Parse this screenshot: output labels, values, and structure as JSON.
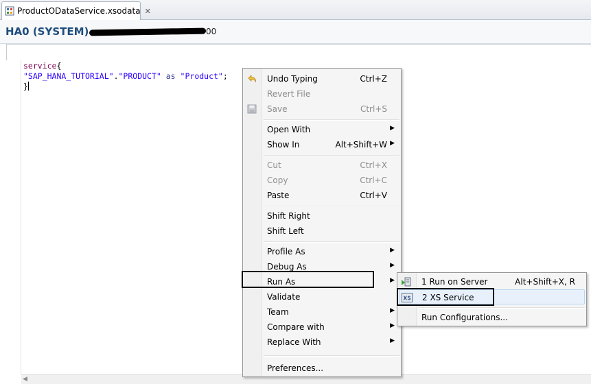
{
  "editor_tab": {
    "filename": "ProductODataService.xsodata",
    "file_icon": "xsodata-file-icon",
    "close_icon": "close-icon"
  },
  "system_header": {
    "title": "HA0 (SYSTEM)",
    "suffix": "00"
  },
  "editor": {
    "lines": [
      {
        "keyword": "service",
        "brace": "{"
      },
      {
        "schema": "\"SAP_HANA_TUTORIAL\"",
        "dot": ".",
        "table": "\"PRODUCT\"",
        "as_kw": "as",
        "alias": "\"Product\"",
        "semi": ";"
      },
      {
        "close": "}"
      }
    ]
  },
  "context_menu": {
    "items": [
      {
        "label": "Undo Typing",
        "shortcut": "Ctrl+Z",
        "icon": "undo-icon"
      },
      {
        "label": "Revert File",
        "shortcut": ""
      },
      {
        "label": "Save",
        "shortcut": "Ctrl+S",
        "icon": "save-icon"
      },
      {
        "label": "Open With",
        "shortcut": ""
      },
      {
        "label": "Show In",
        "shortcut": "Alt+Shift+W"
      },
      {
        "label": "Cut",
        "shortcut": "Ctrl+X"
      },
      {
        "label": "Copy",
        "shortcut": "Ctrl+C"
      },
      {
        "label": "Paste",
        "shortcut": "Ctrl+V"
      },
      {
        "label": "Shift Right",
        "shortcut": ""
      },
      {
        "label": "Shift Left",
        "shortcut": ""
      },
      {
        "label": "Profile As",
        "shortcut": ""
      },
      {
        "label": "Debug As",
        "shortcut": ""
      },
      {
        "label": "Run As",
        "shortcut": ""
      },
      {
        "label": "Validate",
        "shortcut": ""
      },
      {
        "label": "Team",
        "shortcut": ""
      },
      {
        "label": "Compare with",
        "shortcut": ""
      },
      {
        "label": "Replace With",
        "shortcut": ""
      },
      {
        "label": "Preferences...",
        "shortcut": ""
      }
    ],
    "submenu_arrow": "▶"
  },
  "run_as_submenu": {
    "items": [
      {
        "label": "1 Run on Server",
        "shortcut": "Alt+Shift+X, R",
        "icon": "run-on-server-icon"
      },
      {
        "label": "2 XS Service",
        "shortcut": "",
        "icon": "xs-service-icon",
        "icon_text": "XS"
      },
      {
        "label": "Run Configurations...",
        "shortcut": ""
      }
    ]
  },
  "colors": {
    "header_title": "#1f4d7d",
    "keyword": "#7f0055",
    "string": "#2a00ff",
    "menu_background": "#f5f5f5",
    "disabled_text": "#8d8d8d"
  }
}
